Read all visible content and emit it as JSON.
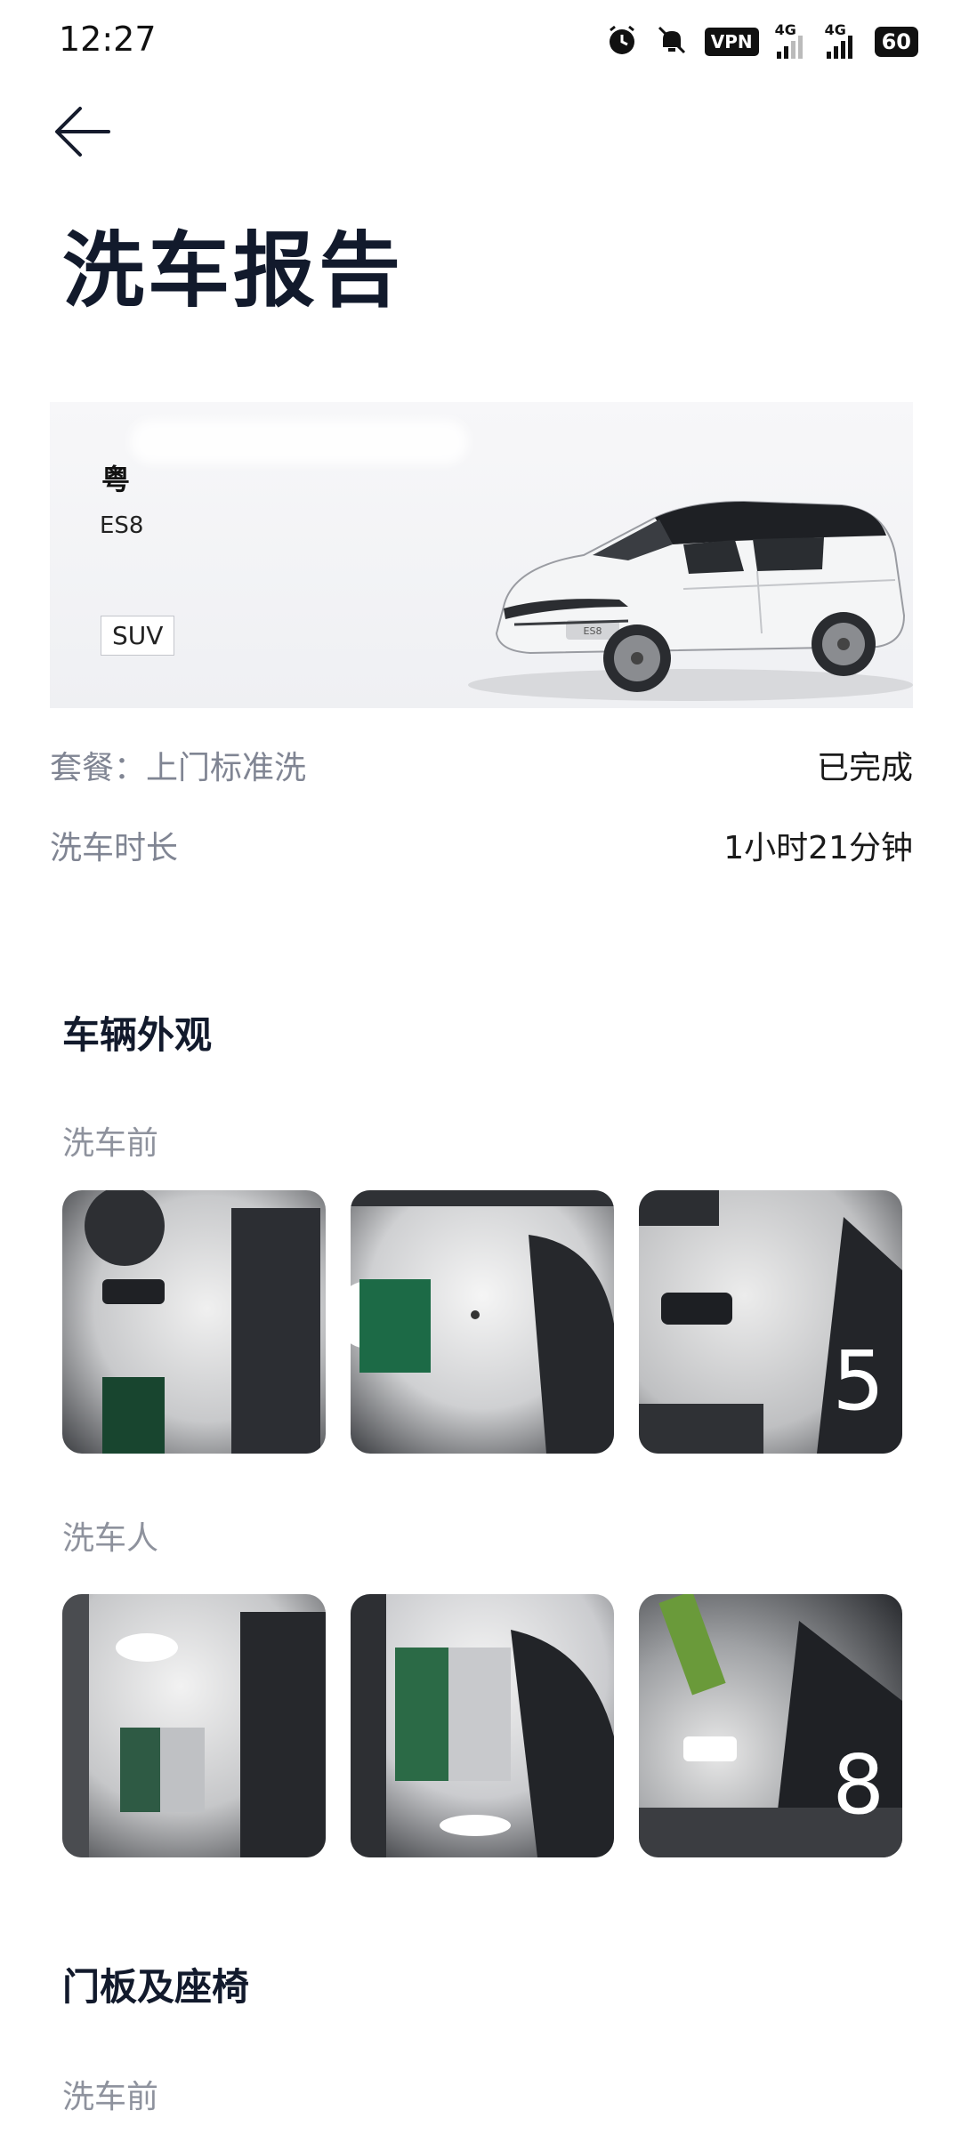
{
  "status_bar": {
    "time": "12:27",
    "vpn": "VPN",
    "network1": "4G",
    "network2": "4G",
    "battery": "60"
  },
  "page": {
    "title": "洗车报告"
  },
  "vehicle": {
    "plate_prefix": "粤",
    "model": "ES8",
    "body_type": "SUV"
  },
  "info": {
    "package_label": "套餐：上门标准洗",
    "status": "已完成",
    "duration_label": "洗车时长",
    "duration_value": "1小时21分钟"
  },
  "sections": {
    "exterior": {
      "title": "车辆外观",
      "before_label": "洗车前",
      "after_label": "洗车⼈",
      "before_last_count": "5",
      "after_last_count": "8"
    },
    "door_seats": {
      "title": "门板及座椅",
      "before_label": "洗车前"
    }
  },
  "icons": {
    "back": "arrow-left-icon",
    "alarm": "alarm-icon",
    "mute": "bell-off-icon"
  }
}
